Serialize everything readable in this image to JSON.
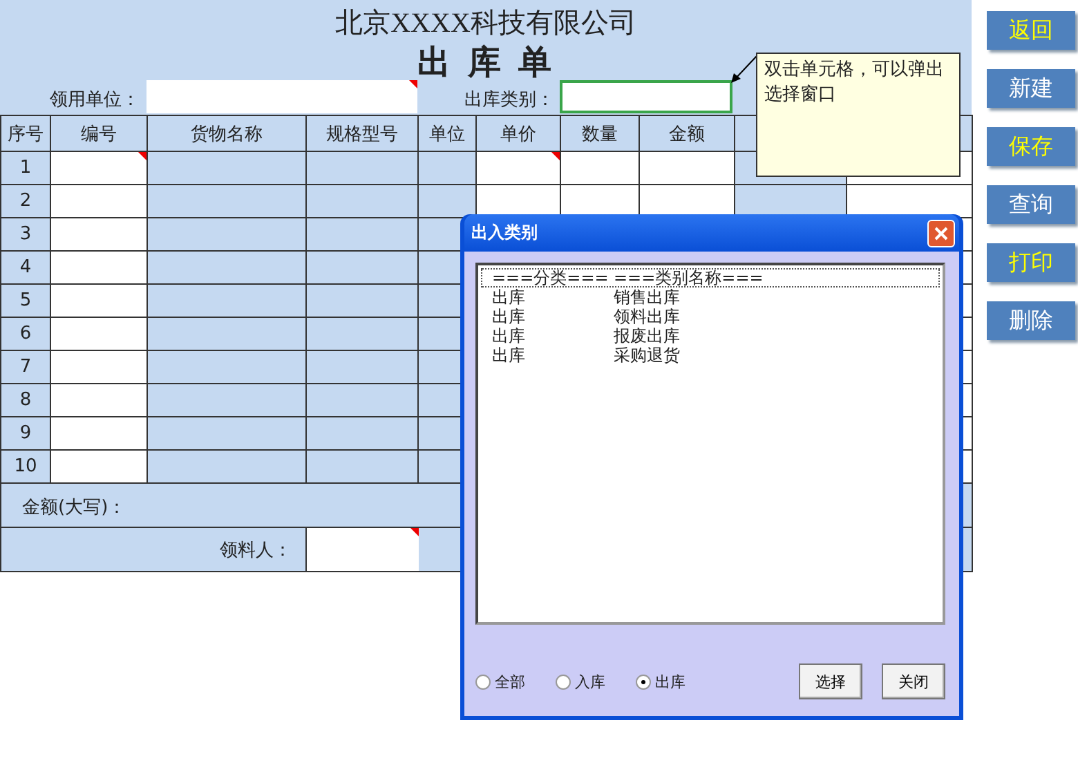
{
  "sheet": {
    "company": "北京XXXX科技有限公司",
    "title": "出 库 单",
    "fields": [
      {
        "label": "领用单位：",
        "note": true,
        "selected": false
      },
      {
        "label": "出库类别：",
        "note": false,
        "selected": true
      }
    ],
    "columns": [
      {
        "label": "序号",
        "kind": "index",
        "note": false
      },
      {
        "label": "编号",
        "kind": "entry",
        "note": true
      },
      {
        "label": "货物名称",
        "kind": "fixed",
        "note": false
      },
      {
        "label": "规格型号",
        "kind": "fixed",
        "note": false
      },
      {
        "label": "单位",
        "kind": "fixed",
        "note": false
      },
      {
        "label": "单价",
        "kind": "entry",
        "note": true
      },
      {
        "label": "数量",
        "kind": "entry",
        "note": false
      },
      {
        "label": "金额",
        "kind": "entry",
        "note": false
      }
    ],
    "rows": [
      "1",
      "2",
      "3",
      "4",
      "5",
      "6",
      "7",
      "8",
      "9",
      "10"
    ],
    "amount_label": "金额(大写)：",
    "receiver_label": "领料人："
  },
  "comment": {
    "text": "双击单元格，可以弹出选择窗口"
  },
  "side_buttons": [
    {
      "label": "返回",
      "highlighted": true
    },
    {
      "label": "新建",
      "highlighted": false
    },
    {
      "label": "保存",
      "highlighted": true
    },
    {
      "label": "查询",
      "highlighted": false
    },
    {
      "label": "打印",
      "highlighted": true
    },
    {
      "label": "删除",
      "highlighted": false
    }
  ],
  "dialog": {
    "title": "出入类别",
    "list_header": [
      "===分类===",
      "===类别名称==="
    ],
    "items": [
      [
        "出库",
        "销售出库"
      ],
      [
        "出库",
        "领料出库"
      ],
      [
        "出库",
        "报废出库"
      ],
      [
        "出库",
        "采购退货"
      ]
    ],
    "radios": [
      {
        "label": "全部",
        "selected": false
      },
      {
        "label": "入库",
        "selected": false
      },
      {
        "label": "出库",
        "selected": true
      }
    ],
    "buttons": [
      "选择",
      "关闭"
    ]
  }
}
